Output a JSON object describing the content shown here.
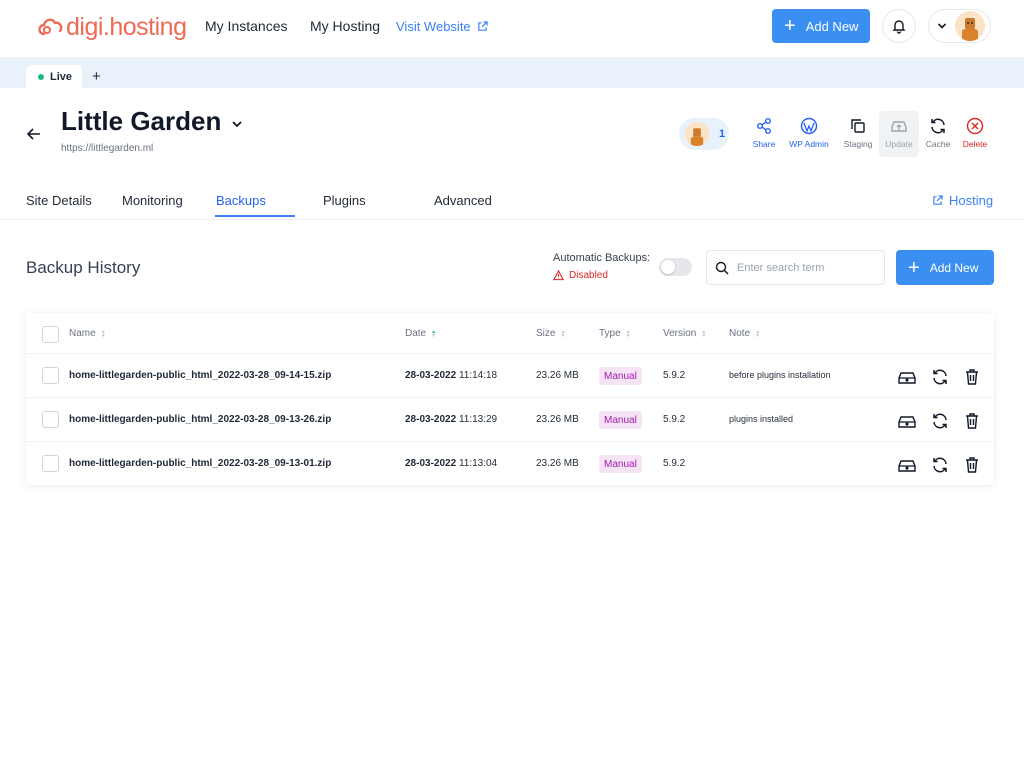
{
  "brand": {
    "logo_text": "digi.hosting"
  },
  "nav": {
    "my_instances": "My Instances",
    "my_hosting": "My Hosting",
    "visit_website": "Visit Website",
    "add_new": "Add New"
  },
  "env_tabs": {
    "live": "Live",
    "add": "+"
  },
  "site": {
    "title": "Little Garden",
    "url": "https://littlegarden.ml",
    "collaborators_count": "1"
  },
  "actions": {
    "share": "Share",
    "wp_admin": "WP Admin",
    "staging": "Staging",
    "update": "Update",
    "cache": "Cache",
    "delete": "Delete"
  },
  "section_tabs": {
    "site_details": "Site Details",
    "monitoring": "Monitoring",
    "backups": "Backups",
    "plugins": "Plugins",
    "advanced": "Advanced",
    "hosting": "Hosting"
  },
  "backups": {
    "title": "Backup History",
    "auto_label": "Automatic Backups:",
    "auto_status": "Disabled",
    "auto_enabled": false,
    "search_placeholder": "Enter search term",
    "add_new": "Add New"
  },
  "table": {
    "columns": {
      "name": "Name",
      "date": "Date",
      "size": "Size",
      "type": "Type",
      "version": "Version",
      "note": "Note"
    },
    "rows": [
      {
        "name": "home-littlegarden-public_html_2022-03-28_09-14-15.zip",
        "date_day": "28-03-2022",
        "date_time": "11:14:18",
        "size": "23.26 MB",
        "type": "Manual",
        "version": "5.9.2",
        "note": "before plugins installation"
      },
      {
        "name": "home-littlegarden-public_html_2022-03-28_09-13-26.zip",
        "date_day": "28-03-2022",
        "date_time": "11:13:29",
        "size": "23.26 MB",
        "type": "Manual",
        "version": "5.9.2",
        "note": "plugins installed"
      },
      {
        "name": "home-littlegarden-public_html_2022-03-28_09-13-01.zip",
        "date_day": "28-03-2022",
        "date_time": "11:13:04",
        "size": "23.26 MB",
        "type": "Manual",
        "version": "5.9.2",
        "note": ""
      }
    ]
  },
  "colors": {
    "primary": "#3b8ff0",
    "accent_link": "#3b82f6",
    "danger": "#dc2626",
    "live": "#16b981",
    "badge_bg": "#f6e3f5",
    "badge_text": "#a21caf"
  },
  "icons": [
    "external-link-icon",
    "bell-icon",
    "chevron-down-icon",
    "back-arrow-icon",
    "share-icon",
    "wordpress-icon",
    "copy-icon",
    "update-icon",
    "refresh-icon",
    "close-circle-icon",
    "warning-icon",
    "search-icon",
    "restore-icon",
    "trash-icon"
  ]
}
